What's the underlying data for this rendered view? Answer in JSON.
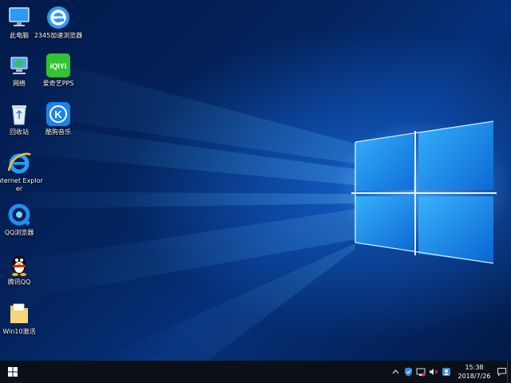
{
  "desktop": {
    "icons": [
      {
        "label": "此电脑",
        "icon": "computer-icon"
      },
      {
        "label": "2345加速浏览器",
        "icon": "browser-2345-icon"
      },
      {
        "label": "网络",
        "icon": "network-icon"
      },
      {
        "label": "爱奇艺PPS",
        "icon": "iqiyi-icon"
      },
      {
        "label": "回收站",
        "icon": "recycle-bin-icon"
      },
      {
        "label": "酷狗音乐",
        "icon": "kugou-icon"
      },
      {
        "label": "Internet Explorer",
        "icon": "internet-explorer-icon"
      },
      {
        "label": "QQ浏览器",
        "icon": "qq-browser-icon"
      },
      {
        "label": "腾讯QQ",
        "icon": "qq-penguin-icon"
      },
      {
        "label": "Win10激活",
        "icon": "folder-icon"
      }
    ],
    "iqiyi_logo_text": "iQIYI",
    "kugou_logo_text": "K"
  },
  "taskbar": {
    "start": "windows-logo-icon",
    "tray": [
      "chevron-up-icon",
      "security-shield-icon",
      "network-tray-icon",
      "volume-muted-icon",
      "user-tray-icon"
    ],
    "clock": {
      "time": "15:38",
      "date": "2018/7/26"
    },
    "notification": "notification-icon"
  },
  "colors": {
    "accent": "#0078d7",
    "taskbar": "#0b0f18",
    "wallpaper_glow": "#5ec6ff"
  }
}
